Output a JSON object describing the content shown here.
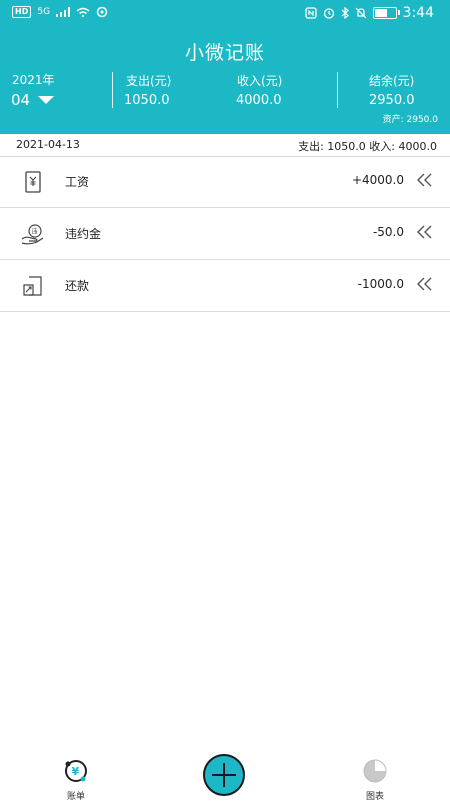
{
  "status_bar": {
    "hd": "HD",
    "network": "5G",
    "time": "3:44",
    "battery_level": 0.55
  },
  "header": {
    "app_title": "小微记账",
    "year": "2021年",
    "month": "04",
    "columns": [
      {
        "label": "支出(元)",
        "value": "1050.0"
      },
      {
        "label": "收入(元)",
        "value": "4000.0"
      },
      {
        "label": "结余(元)",
        "value": "2950.0"
      }
    ],
    "assets": "资产:  2950.0"
  },
  "day": {
    "date": "2021-04-13",
    "summary": "支出:  1050.0  收入:  4000.0"
  },
  "records": [
    {
      "icon": "salary-icon",
      "label": "工资",
      "amount": "+4000.0"
    },
    {
      "icon": "penalty-icon",
      "label": "违约金",
      "amount": "-50.0"
    },
    {
      "icon": "repayment-icon",
      "label": "还款",
      "amount": "-1000.0"
    }
  ],
  "bottom_nav": {
    "bills_label": "账单",
    "charts_label": "图表"
  },
  "colors": {
    "accent": "#1cb8c6",
    "text": "#222222",
    "divider": "#dcdcdc"
  }
}
